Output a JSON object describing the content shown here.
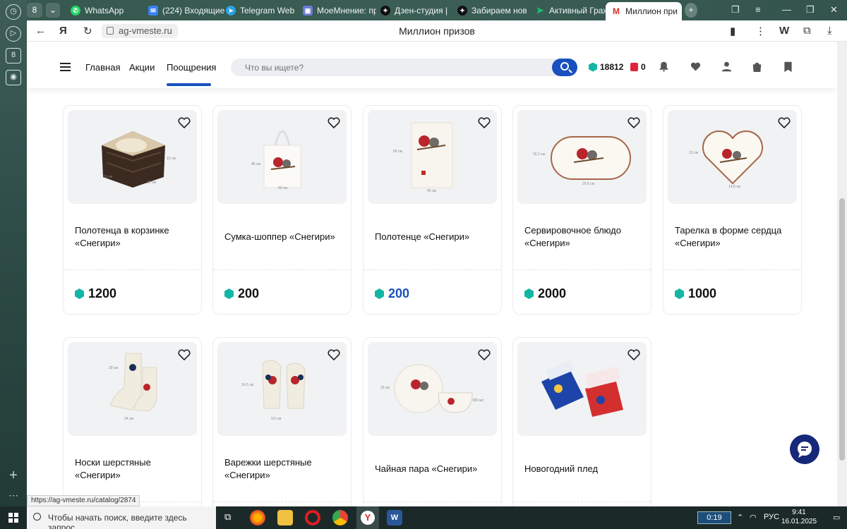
{
  "browser": {
    "tab_count": "8",
    "tabs": [
      {
        "label": "WhatsApp"
      },
      {
        "label": "(224) Входящие"
      },
      {
        "label": "Telegram Web"
      },
      {
        "label": "МоеМнение: пр"
      },
      {
        "label": "Дзен-студия | З"
      },
      {
        "label": "Забираем новы"
      },
      {
        "label": "Активный Граж"
      },
      {
        "label": "Миллион при"
      }
    ],
    "url": "ag-vmeste.ru",
    "page_title": "Миллион призов",
    "status_url": "https://ag-vmeste.ru/catalog/2874"
  },
  "header": {
    "nav": [
      "Главная",
      "Акции",
      "Поощрения"
    ],
    "search_placeholder": "Что вы ищете?",
    "points": "18812",
    "red_points": "0"
  },
  "products": [
    {
      "name": "Полотенца в корзинке «Снегири»",
      "price": "1200",
      "highlight": false
    },
    {
      "name": "Сумка-шоппер «Снегири»",
      "price": "200",
      "highlight": false
    },
    {
      "name": "Полотенце «Снегири»",
      "price": "200",
      "highlight": true
    },
    {
      "name": "Сервировочное блюдо «Снегири»",
      "price": "2000",
      "highlight": false
    },
    {
      "name": "Тарелка в форме сердца «Снегири»",
      "price": "1000",
      "highlight": false
    },
    {
      "name": "Носки шерстяные «Снегири»",
      "price": "",
      "highlight": false
    },
    {
      "name": "Варежки шерстяные «Снегири»",
      "price": "",
      "highlight": false
    },
    {
      "name": "Чайная пара «Снегири»",
      "price": "",
      "highlight": false
    },
    {
      "name": "Новогодний плед",
      "price": "",
      "highlight": false
    }
  ],
  "dims": {
    "basket": [
      "10 см",
      "15 см",
      "15 см"
    ],
    "bag": [
      "45 см",
      "40 см"
    ],
    "towel": [
      "60 см",
      "40 см"
    ],
    "dish": [
      "16.2 см",
      "29.5 см"
    ],
    "heart": [
      "13 см",
      "14.8 см"
    ],
    "socks": [
      "20 см",
      "24 см"
    ],
    "mittens": [
      "24.5 см",
      "9.5 см"
    ],
    "teaset": [
      "15 см",
      "300 мл"
    ]
  },
  "taskbar": {
    "search_placeholder": "Чтобы начать поиск, введите здесь запрос",
    "timer": "0:19",
    "lang": "РУС",
    "time": "9:41",
    "date": "16.01.2025"
  },
  "colors": {
    "accent": "#1a4fbf",
    "gem": "#13b6a5",
    "chat": "#17287a"
  }
}
